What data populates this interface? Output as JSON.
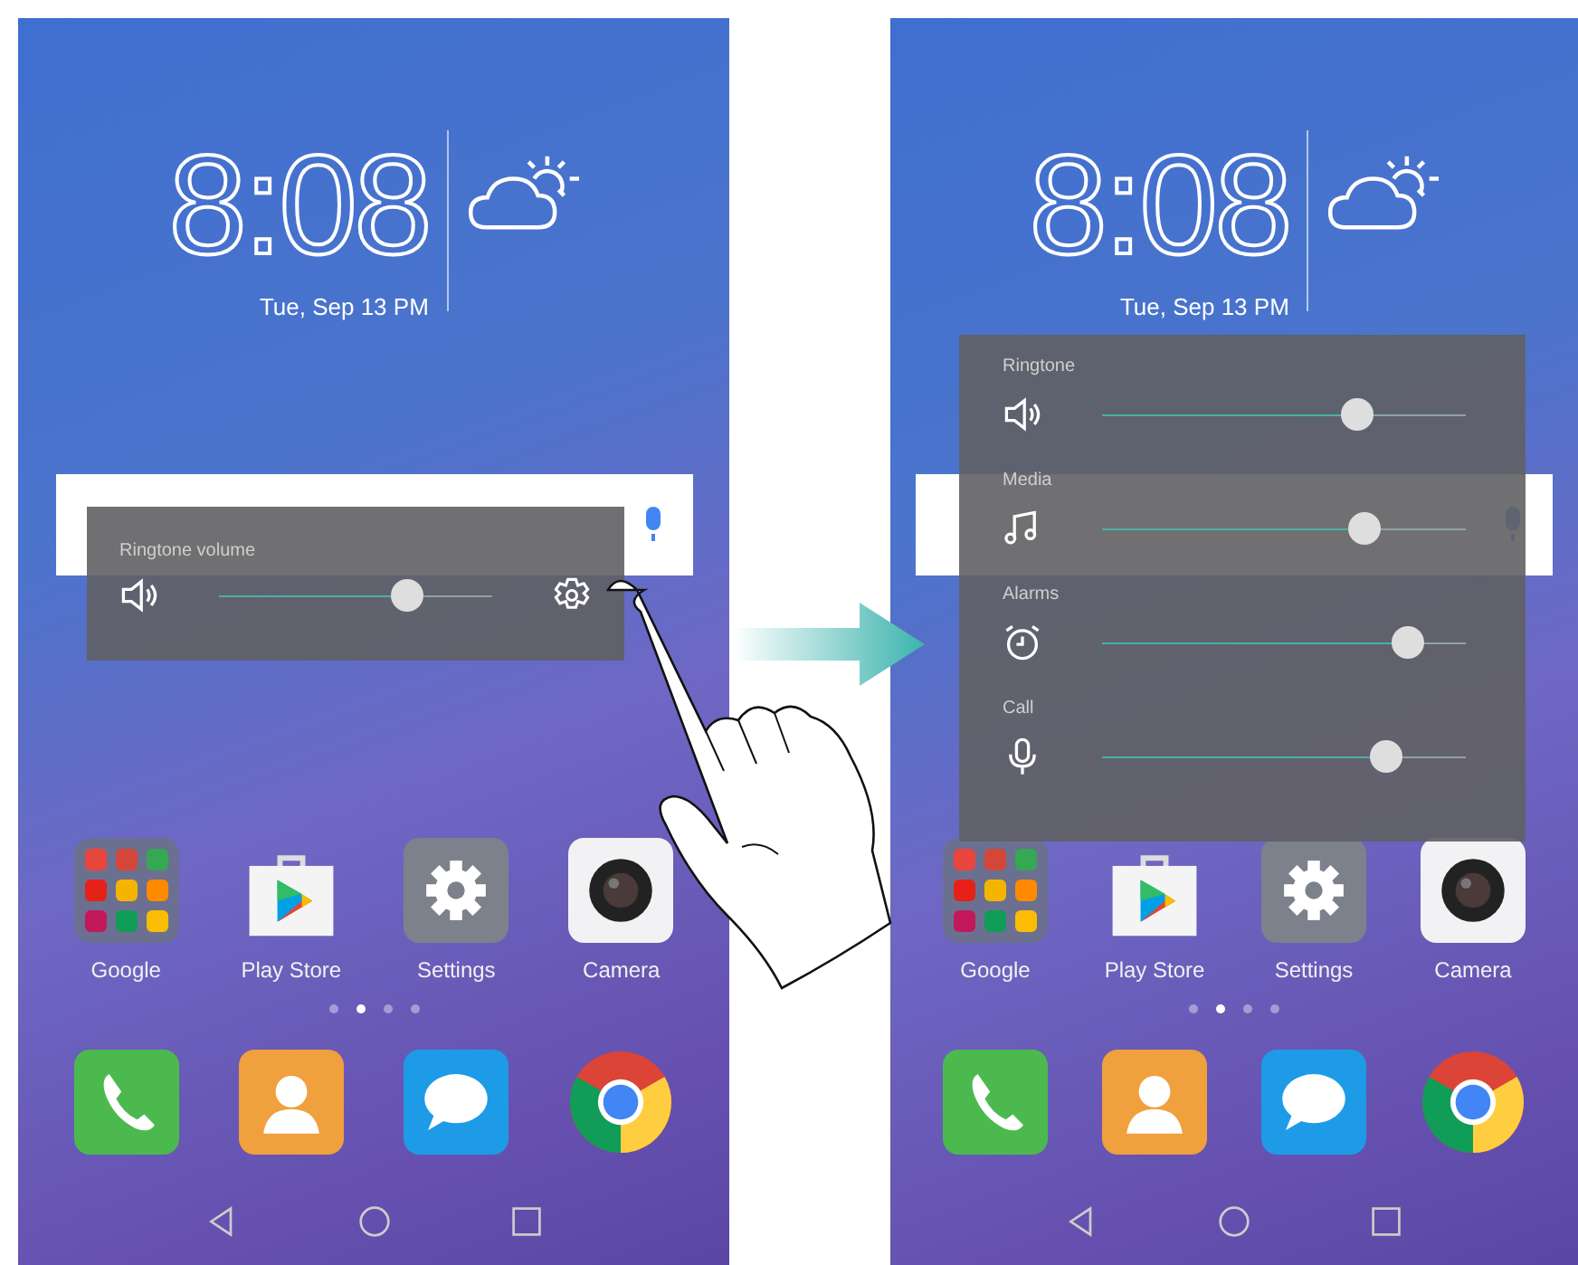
{
  "screens": [
    {
      "clock": {
        "time": "8:08",
        "date": "Tue, Sep 13 PM"
      },
      "volume_panel": {
        "kind": "compact",
        "sliders": [
          {
            "kind": "ringtone",
            "label": "Ringtone volume",
            "level": 0.69
          }
        ]
      },
      "apps": [
        {
          "kind": "folder",
          "label": "Google"
        },
        {
          "kind": "store",
          "label": "Play Store"
        },
        {
          "kind": "settings",
          "label": "Settings"
        },
        {
          "kind": "camera",
          "label": "Camera"
        }
      ],
      "page_dots": [
        {
          "selected": false
        },
        {
          "selected": true
        },
        {
          "selected": false
        },
        {
          "selected": false
        }
      ],
      "dock": [
        {
          "kind": "phone"
        },
        {
          "kind": "contacts"
        },
        {
          "kind": "messages"
        },
        {
          "kind": "browser"
        }
      ]
    },
    {
      "clock": {
        "time": "8:08",
        "date": "Tue, Sep 13 PM"
      },
      "volume_panel": {
        "kind": "expanded",
        "sliders": [
          {
            "kind": "ringtone",
            "label": "Ringtone",
            "level": 0.7
          },
          {
            "kind": "media",
            "label": "Media",
            "level": 0.72
          },
          {
            "kind": "alarms",
            "label": "Alarms",
            "level": 0.84
          },
          {
            "kind": "call",
            "label": "Call",
            "level": 0.78
          }
        ]
      },
      "apps": [
        {
          "kind": "folder",
          "label": "Google"
        },
        {
          "kind": "store",
          "label": "Play Store"
        },
        {
          "kind": "settings",
          "label": "Settings"
        },
        {
          "kind": "camera",
          "label": "Camera"
        }
      ],
      "page_dots": [
        {
          "selected": false
        },
        {
          "selected": true
        },
        {
          "selected": false
        },
        {
          "selected": false
        }
      ],
      "dock": [
        {
          "kind": "phone"
        },
        {
          "kind": "contacts"
        },
        {
          "kind": "messages"
        },
        {
          "kind": "browser"
        }
      ]
    }
  ]
}
